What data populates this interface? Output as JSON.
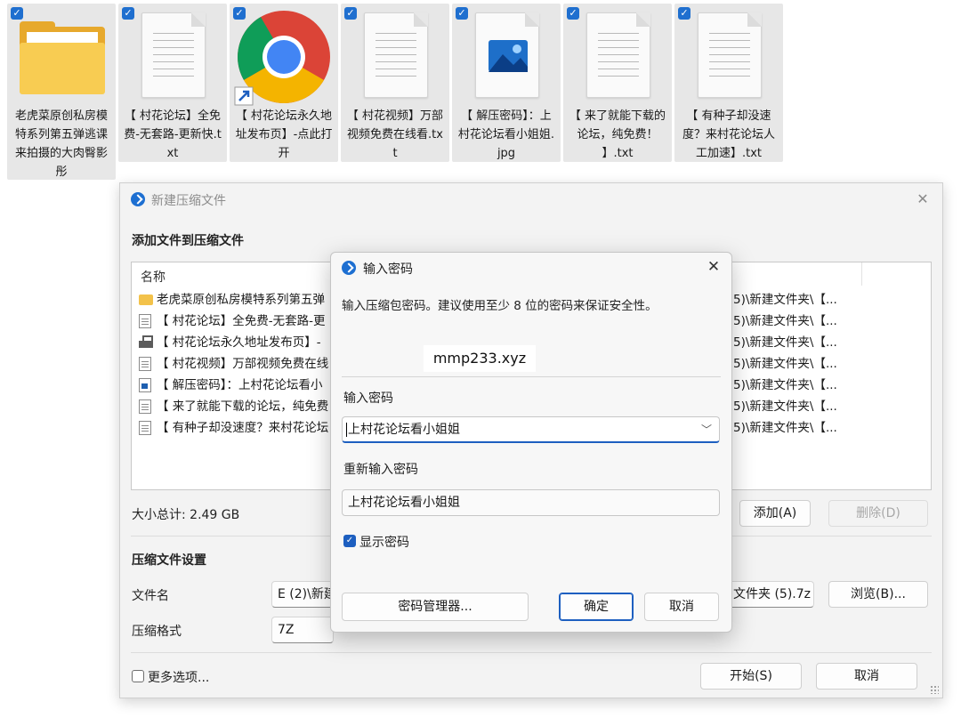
{
  "desktop": {
    "files": [
      {
        "name": "老虎菜原创私房模特系列第五弹逃课来拍摄的大肉臀影彤",
        "icon": "folder-icon",
        "checked": true
      },
      {
        "name": "【 村花论坛】全免费-无套路-更新快.txt",
        "icon": "text-document-icon",
        "checked": true
      },
      {
        "name": "【 村花论坛永久地址发布页】-点此打开",
        "icon": "chrome-shortcut-icon",
        "checked": true
      },
      {
        "name": "【 村花视频】万部视频免费在线看.txt",
        "icon": "text-document-icon",
        "checked": true
      },
      {
        "name": "【 解压密码】：上村花论坛看小姐姐.jpg",
        "icon": "image-file-icon",
        "checked": true
      },
      {
        "name": "【 来了就能下载的论坛，纯免费！ 】.txt",
        "icon": "text-document-icon",
        "checked": true
      },
      {
        "name": "【 有种子却没速度？来村花论坛人工加速】.txt",
        "icon": "text-document-icon",
        "checked": true
      }
    ]
  },
  "archive_dialog": {
    "title": "新建压缩文件",
    "close": "✕",
    "add_section": "添加文件到压缩文件",
    "list_header": "名称",
    "rows": [
      {
        "name": "老虎菜原创私房模特系列第五弹",
        "path": "5)\\新建文件夹\\【...",
        "icon": "folder-icon"
      },
      {
        "name": "【 村花论坛】全免费-无套路-更",
        "path": "5)\\新建文件夹\\【...",
        "icon": "document-icon"
      },
      {
        "name": "【 村花论坛永久地址发布页】-",
        "path": "5)\\新建文件夹\\【...",
        "icon": "shortcut-icon"
      },
      {
        "name": "【 村花视频】万部视频免费在线",
        "path": "5)\\新建文件夹\\【...",
        "icon": "document-icon"
      },
      {
        "name": "【 解压密码】：上村花论坛看小",
        "path": "5)\\新建文件夹\\【...",
        "icon": "image-icon"
      },
      {
        "name": "【 来了就能下载的论坛，纯免费",
        "path": "5)\\新建文件夹\\【...",
        "icon": "document-icon"
      },
      {
        "name": "【 有种子却没速度？来村花论坛",
        "path": "5)\\新建文件夹\\【...",
        "icon": "document-icon"
      }
    ],
    "total_size": "大小总计: 2.49 GB",
    "add_button": "添加(A)",
    "delete_button": "删除(D)",
    "settings_section": "压缩文件设置",
    "filename_label": "文件名",
    "filename_value_left": "E (2)\\新建",
    "filename_value_right": "文件夹 (5).7z",
    "browse_button": "浏览(B)...",
    "format_label": "压缩格式",
    "format_value": "7Z",
    "more_options": "更多选项...",
    "start_button": "开始(S)",
    "cancel_button": "取消"
  },
  "password_dialog": {
    "title": "输入密码",
    "close": "✕",
    "info": "输入压缩包密码。建议使用至少 8 位的密码来保证安全性。",
    "watermark": "mmp233.xyz",
    "password_label": "输入密码",
    "password_value": "上村花论坛看小姐姐",
    "confirm_label": "重新输入密码",
    "confirm_value": "上村花论坛看小姐姐",
    "show_password": "显示密码",
    "show_password_checked": true,
    "manager_button": "密码管理器...",
    "ok_button": "确定",
    "cancel_button": "取消"
  },
  "colors": {
    "accent": "#1d5fc0",
    "folder": "#f8cc52",
    "tile_bg": "#e7e7e7"
  }
}
